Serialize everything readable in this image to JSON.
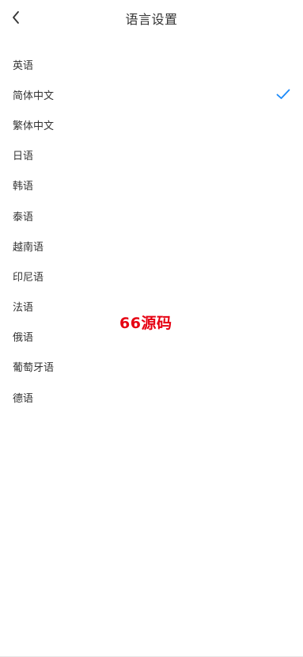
{
  "header": {
    "title": "语言设置",
    "back_icon": "chevron-left-icon"
  },
  "languages": [
    {
      "label": "英语",
      "selected": false
    },
    {
      "label": "简体中文",
      "selected": true
    },
    {
      "label": "繁体中文",
      "selected": false
    },
    {
      "label": "日语",
      "selected": false
    },
    {
      "label": "韩语",
      "selected": false
    },
    {
      "label": "泰语",
      "selected": false
    },
    {
      "label": "越南语",
      "selected": false
    },
    {
      "label": "印尼语",
      "selected": false
    },
    {
      "label": "法语",
      "selected": false
    },
    {
      "label": "俄语",
      "selected": false
    },
    {
      "label": "葡萄牙语",
      "selected": false
    },
    {
      "label": "德语",
      "selected": false
    }
  ],
  "selected_icon": "checkmark-icon",
  "watermark": "66源码",
  "colors": {
    "accent": "#1989fa",
    "text": "#333333",
    "watermark": "#e60012"
  }
}
